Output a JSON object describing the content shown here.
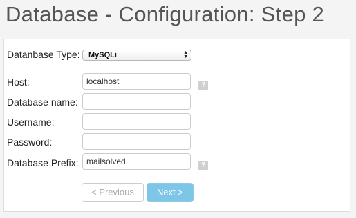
{
  "page": {
    "title": "Database - Configuration: Step 2"
  },
  "form": {
    "db_type": {
      "label": "Datanbase Type:",
      "value": "MySQLi"
    },
    "host": {
      "label": "Host:",
      "value": "localhost",
      "help": "?"
    },
    "db_name": {
      "label": "Database name:",
      "value": ""
    },
    "username": {
      "label": "Username:",
      "value": ""
    },
    "password": {
      "label": "Password:",
      "value": ""
    },
    "prefix": {
      "label": "Database Prefix:",
      "value": "mailsolved",
      "help": "?"
    }
  },
  "buttons": {
    "previous": "< Previous",
    "next": "Next >"
  },
  "colors": {
    "next_button": "#7dc6e8",
    "help_icon": "#cfcfcf"
  }
}
